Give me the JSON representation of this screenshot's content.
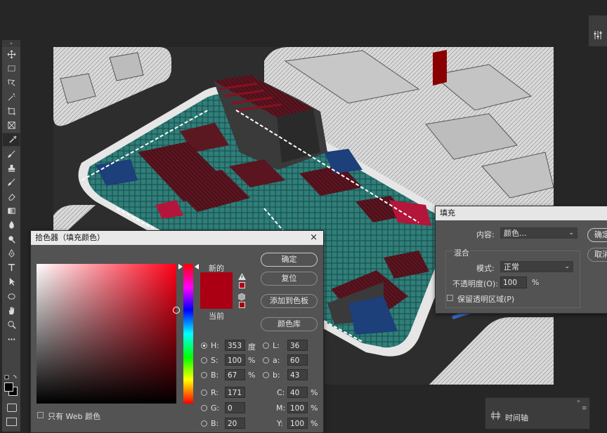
{
  "colors": {
    "app_bg": "#262626",
    "panel": "#535353",
    "accent_new": "#AB0014",
    "current": "#AB0014"
  },
  "toolbar": {
    "grip": "» ",
    "tools": [
      "move-icon",
      "marquee-icon",
      "lasso-icon",
      "magic-wand-icon",
      "crop-icon",
      "frame-icon",
      "eyedropper-icon",
      "healing-brush-icon",
      "brush-icon",
      "stamp-icon",
      "history-brush-icon",
      "eraser-icon",
      "gradient-icon",
      "blur-icon",
      "dodge-icon",
      "pen-icon",
      "type-icon",
      "path-select-icon",
      "ellipse-icon",
      "hand-icon",
      "zoom-icon",
      "more-icon"
    ]
  },
  "picker": {
    "title": "拾色器（填充颜色）",
    "close": "×",
    "new_label": "新的",
    "current_label": "当前",
    "ok": "确定",
    "reset": "复位",
    "add_swatch": "添加到色板",
    "libraries": "颜色库",
    "web_only": "只有 Web 颜色",
    "H": {
      "label": "H:",
      "value": "353",
      "unit": "度"
    },
    "S": {
      "label": "S:",
      "value": "100",
      "unit": "%"
    },
    "Bv": {
      "label": "B:",
      "value": "67",
      "unit": "%"
    },
    "R": {
      "label": "R:",
      "value": "171"
    },
    "G": {
      "label": "G:",
      "value": "0"
    },
    "B": {
      "label": "B:",
      "value": "20"
    },
    "L": {
      "label": "L:",
      "value": "36"
    },
    "a": {
      "label": "a:",
      "value": "60"
    },
    "b": {
      "label": "b:",
      "value": "43"
    },
    "C": {
      "label": "C:",
      "value": "40",
      "unit": "%"
    },
    "M": {
      "label": "M:",
      "value": "100",
      "unit": "%"
    },
    "Y": {
      "label": "Y:",
      "value": "100",
      "unit": "%"
    }
  },
  "fill": {
    "title": "填充",
    "content_label": "内容:",
    "content_value": "颜色...",
    "blend_group": "混合",
    "mode_label": "模式:",
    "mode_value": "正常",
    "opacity_label": "不透明度(O):",
    "opacity_value": "100",
    "opacity_unit": "%",
    "preserve": "保留透明区域(P)",
    "ok": "确定",
    "cancel": "取消"
  },
  "timeline": {
    "grip": "»",
    "label": "时间轴",
    "menu": "≡"
  }
}
